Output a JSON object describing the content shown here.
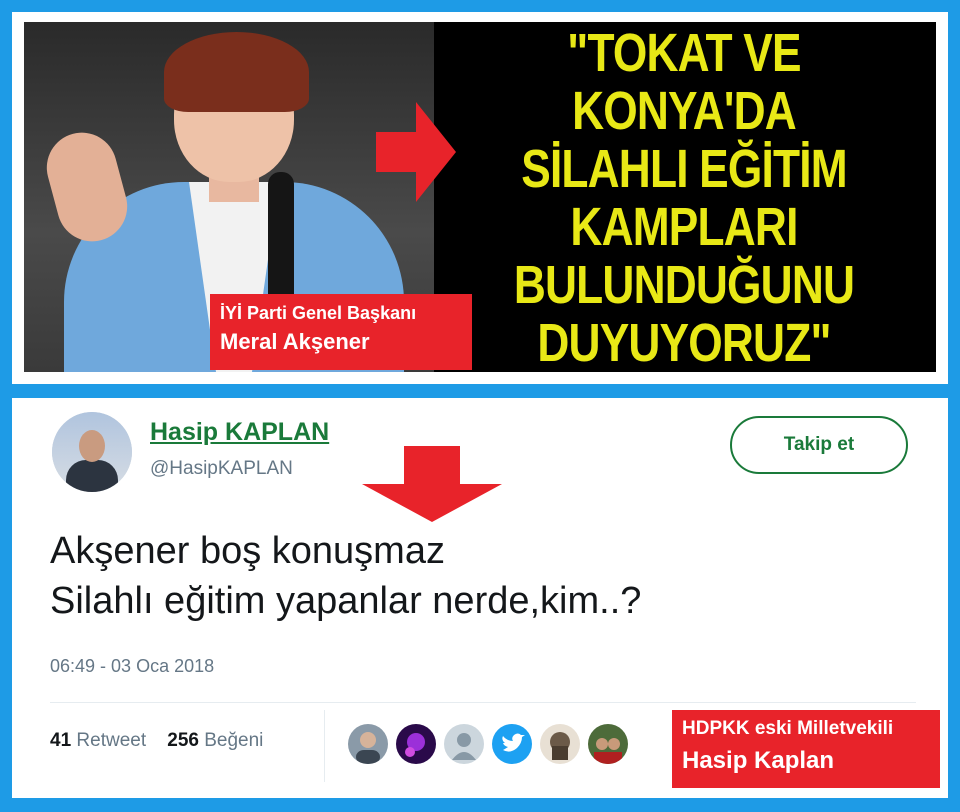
{
  "banner": {
    "quote_lines": [
      "\"TOKAT VE KONYA'DA",
      "SİLAHLI EĞİTİM",
      "KAMPLARI",
      "BULUNDUĞUNU",
      "DUYUYORUZ\""
    ],
    "caption_line1": "İYİ Parti Genel Başkanı",
    "caption_line2": "Meral Akşener",
    "quote_color": "#e8e816",
    "arrow_color": "#e8232a"
  },
  "tweet": {
    "author_name": "Hasip KAPLAN",
    "author_handle": "@HasipKAPLAN",
    "follow_label": "Takip et",
    "text_line1": "Akşener boş konuşmaz",
    "text_line2": "Silahlı eğitim yapanlar nerde,kim..?",
    "timestamp": "06:49 - 03 Oca 2018",
    "retweet_count": "41",
    "retweet_label": "Retweet",
    "like_count": "256",
    "like_label": "Beğeni",
    "likers": [
      "liker-avatar-1",
      "liker-avatar-2",
      "default-avatar-icon",
      "twitter-bird-icon",
      "liker-avatar-5",
      "liker-avatar-6"
    ],
    "accent_color": "#1a7a3a"
  },
  "badge": {
    "line1": "HDPKK eski Milletvekili",
    "line2": "Hasip Kaplan"
  },
  "frame_color": "#1e9be6"
}
